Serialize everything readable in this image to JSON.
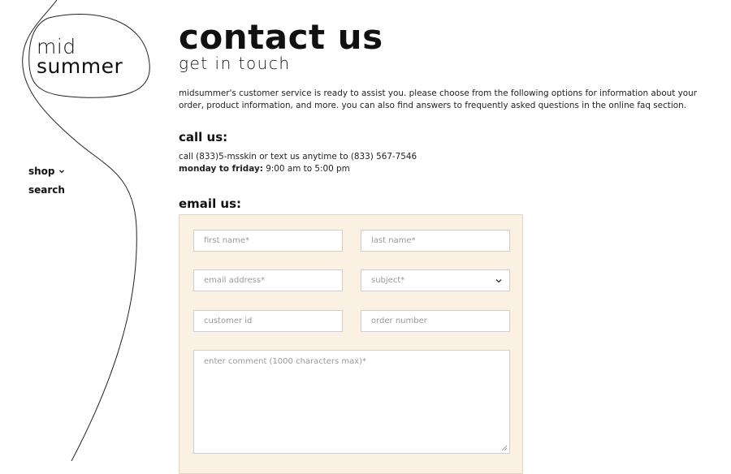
{
  "brand": {
    "line1": "mid",
    "line2": "summer"
  },
  "nav": [
    {
      "label": "shop",
      "has_dropdown": true
    },
    {
      "label": "search",
      "has_dropdown": false
    }
  ],
  "page": {
    "title": "contact us",
    "subtitle": "get in touch",
    "intro": "midsummer's customer service is ready to assist you. please choose from the following options for information about your order, product information, and more. you can also find answers to frequently asked questions in the online faq section."
  },
  "call": {
    "heading": "call us:",
    "line1": "call (833)5-msskin or text us anytime to (833) 567-7546",
    "hours_label": "monday to friday:",
    "hours_value": "9:00 am to 5:00 pm"
  },
  "email": {
    "heading": "email us:",
    "fields": {
      "first_name": "first name*",
      "last_name": "last name*",
      "email": "email address*",
      "subject": "subject*",
      "customer_id": "customer id",
      "order_number": "order number",
      "comment": "enter comment (1000 characters max)*"
    }
  },
  "colors": {
    "form_bg": "#fbf1e3",
    "text": "#111111",
    "placeholder": "#9a9a9a"
  }
}
